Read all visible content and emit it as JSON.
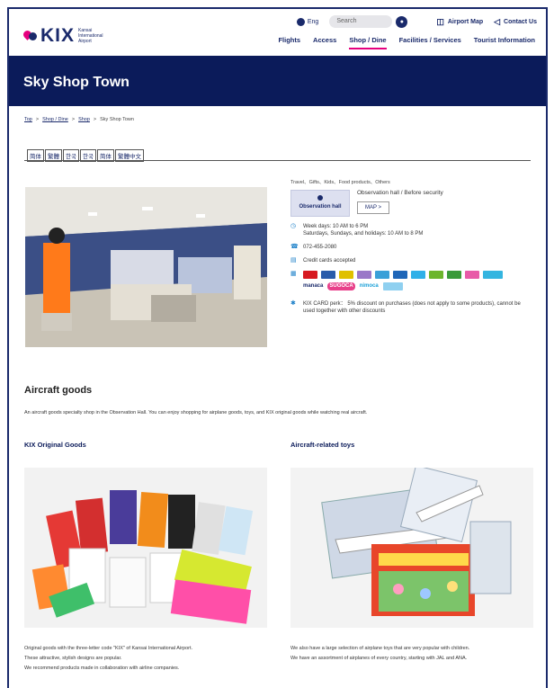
{
  "header": {
    "logo_text": "KIX",
    "logo_sub": "Kansai International Airport",
    "lang": "Eng",
    "search_placeholder": "Search",
    "airport_map": "Airport Map",
    "contact": "Contact Us",
    "nav": [
      "Flights",
      "Access",
      "Shop / Dine",
      "Facilities / Services",
      "Tourist Information"
    ],
    "active_nav": "Shop / Dine"
  },
  "page_title": "Sky Shop Town",
  "breadcrumb": [
    "Top",
    "Shop / Dine",
    "Shop",
    "Sky Shop Town"
  ],
  "lang_tabs": [
    "简体",
    "繁體",
    "한국",
    "한국",
    "简体",
    "繁體中文"
  ],
  "info": {
    "categories": "Travel、Gifts、Kids、Food products、Others",
    "hall_label": "Observation hall",
    "location": "Observation hall / Before security",
    "map_button": "MAP >",
    "hours_line1": "Week days: 10 AM to 6 PM",
    "hours_line2": "Saturdays, Sundays, and holidays: 10 AM to 8 PM",
    "phone": "072-455-2080",
    "payment": "Credit cards accepted",
    "card_label_manaca": "manaca",
    "card_label_suica": "SUGOCA",
    "card_label_nimoca": "nimoca",
    "perk": "KIX CARD perk： 5% discount on purchases (does not apply to some products), cannot be used together with other discounts"
  },
  "section": {
    "title": "Aircraft goods",
    "description": "An aircraft goods specialty shop in the Observation Hall. You can enjoy shopping for airplane goods, toys, and KIX original goods while watching real aircraft."
  },
  "left_col": {
    "title": "KIX Original Goods",
    "text1": "Original goods with the three-letter code \"KIX\" of Kansai International Airport.",
    "text2": "These attractive, stylish designs are popular.",
    "text3": "We recommend products made in collaboration with airline companies."
  },
  "right_col": {
    "title": "Aircraft-related toys",
    "text1": "We also have a large selection of airplane toys that are very popular with children.",
    "text2": "We have an assortment of airplanes of every country, starting with JAL and ANA."
  },
  "colors": {
    "brand_navy": "#0b1b5a",
    "accent_pink": "#e6007e"
  }
}
